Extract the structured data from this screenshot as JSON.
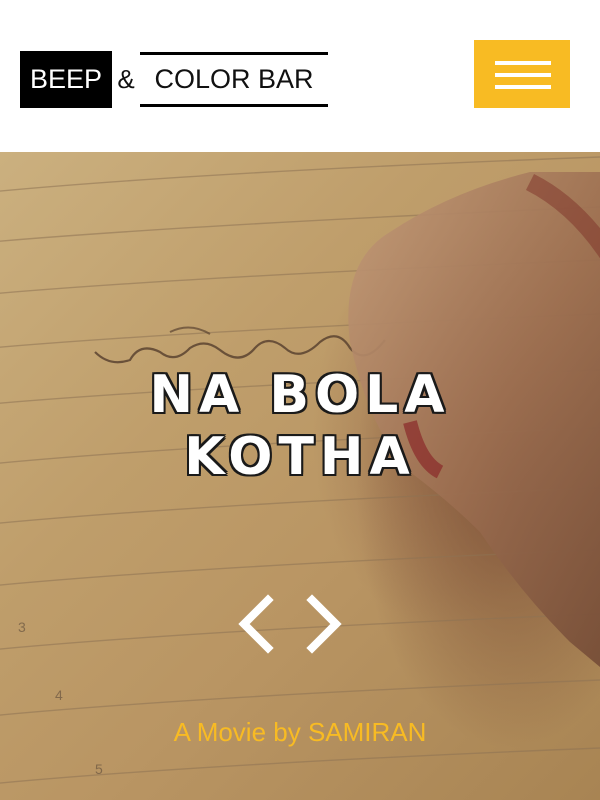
{
  "header": {
    "logo": {
      "part1": "BEEP",
      "amp": "&",
      "part2": "COLOR BAR"
    },
    "menu_icon": "hamburger-menu-icon"
  },
  "hero": {
    "title_line1": "NA BOLA",
    "title_line2": "KOTHA",
    "tagline": "A Movie by SAMIRAN",
    "prev_icon": "chevron-left-icon",
    "next_icon": "chevron-right-icon"
  },
  "colors": {
    "accent": "#f8bb23",
    "logo_bg": "#000000",
    "title_text": "#ffffff"
  }
}
